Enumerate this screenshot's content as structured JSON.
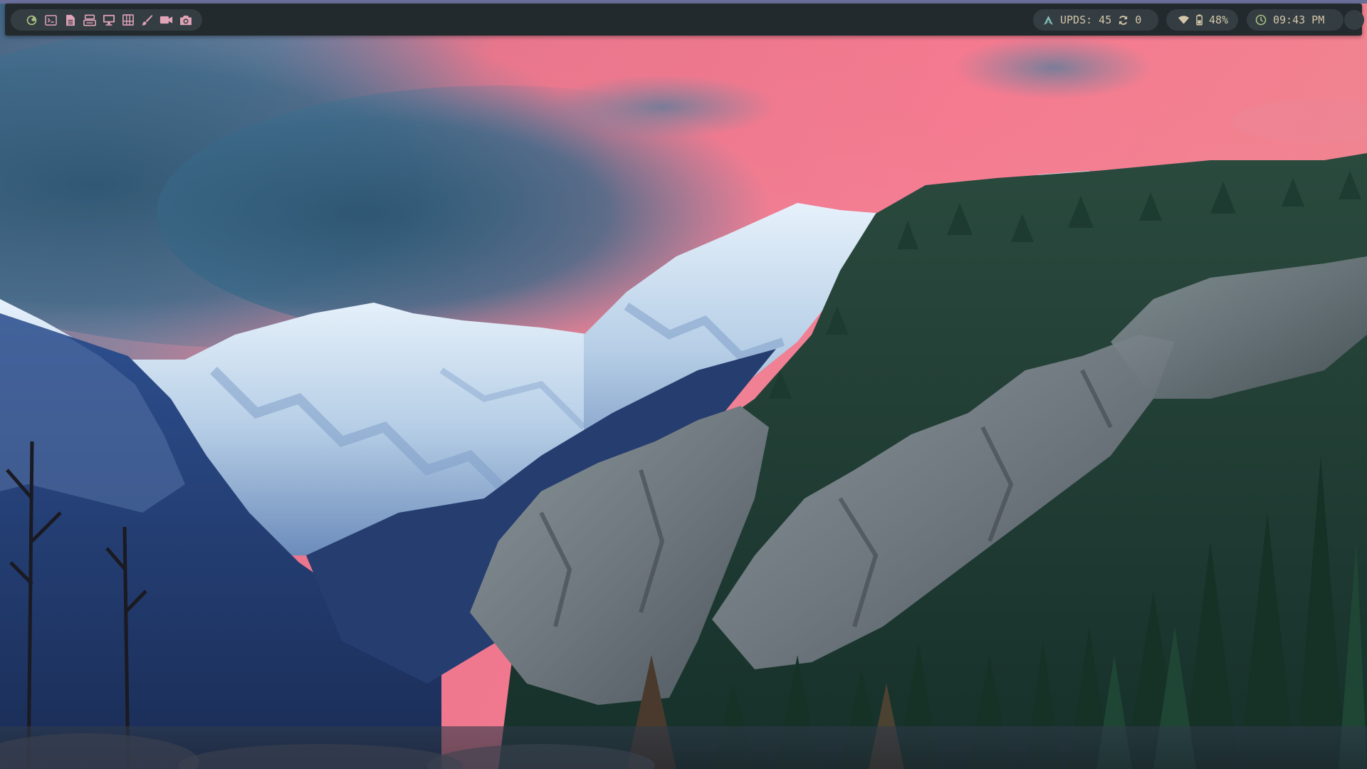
{
  "colors": {
    "bar_bg": "#232a2e",
    "module_bg": "#343d42",
    "text": "#d3c6aa",
    "icon_green": "#a7c080",
    "icon_cyan": "#7fbbb3",
    "icon_pink": "#e0a3b8",
    "sky_pink": "#f07a8c",
    "sky_blue": "#3f6f8f"
  },
  "launcher": {
    "items": [
      {
        "name": "firefox-icon",
        "label": "Firefox"
      },
      {
        "name": "terminal-icon",
        "label": "Terminal"
      },
      {
        "name": "text-editor-icon",
        "label": "Text Editor"
      },
      {
        "name": "files-icon",
        "label": "Files"
      },
      {
        "name": "display-icon",
        "label": "Display"
      },
      {
        "name": "calculator-icon",
        "label": "Calculator"
      },
      {
        "name": "paint-brush-icon",
        "label": "Paint"
      },
      {
        "name": "video-camera-icon",
        "label": "Video Recorder"
      },
      {
        "name": "camera-icon",
        "label": "Screenshot"
      }
    ]
  },
  "updates": {
    "icon": "arch-icon",
    "label": "UPDS: 45",
    "sync_icon": "refresh-icon",
    "pending": "0"
  },
  "network": {
    "wifi_icon": "wifi-icon",
    "battery_icon": "battery-icon",
    "battery": "48%"
  },
  "clock": {
    "icon": "clock-icon",
    "time": "09:43 PM"
  },
  "power": {
    "icon": "power-icon"
  }
}
